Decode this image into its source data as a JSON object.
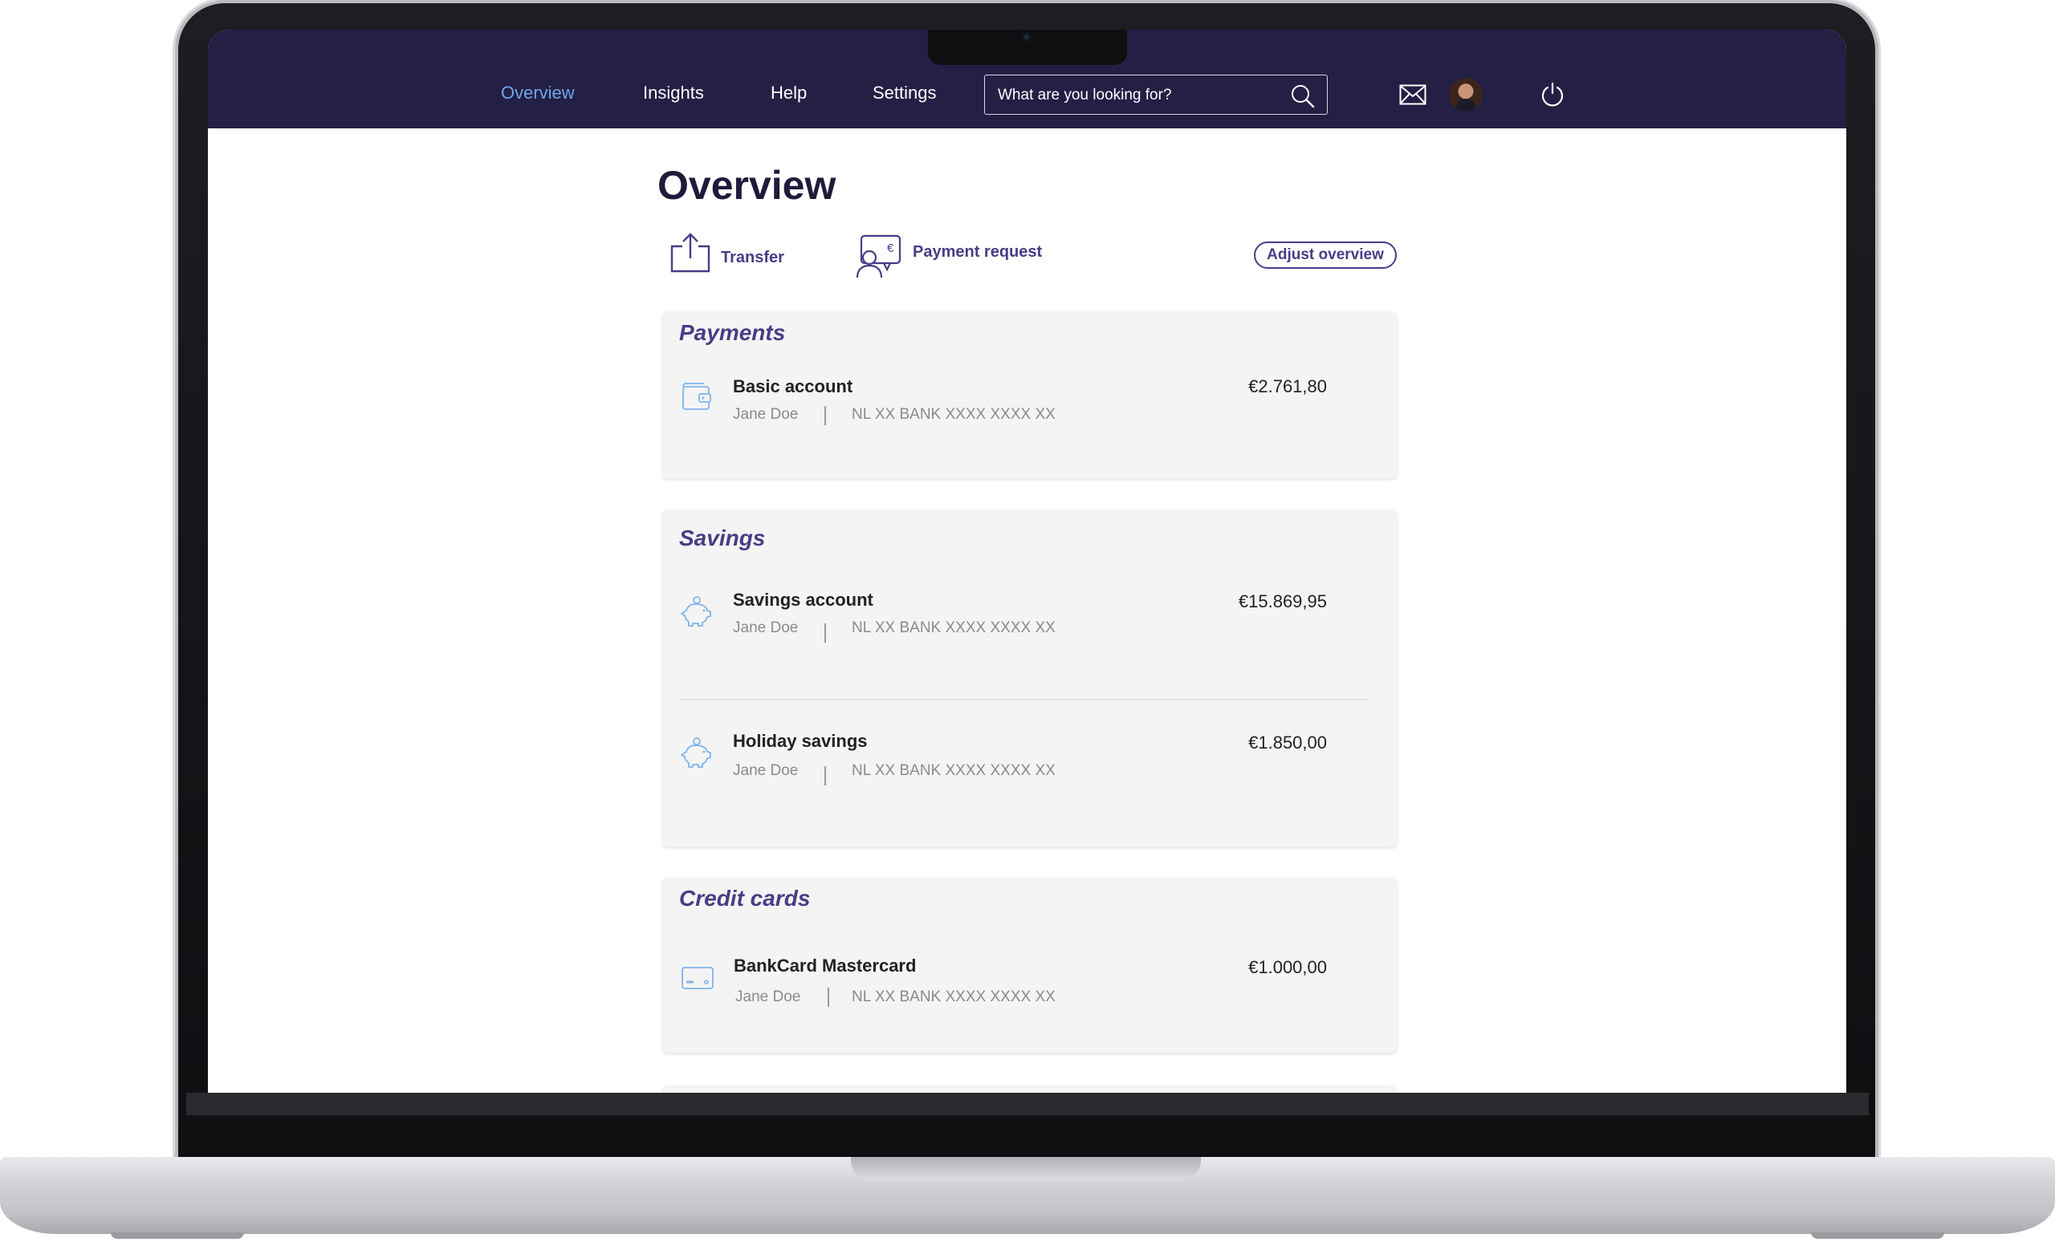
{
  "nav": {
    "items": [
      {
        "label": "Overview",
        "active": true
      },
      {
        "label": "Insights",
        "active": false
      },
      {
        "label": "Help",
        "active": false
      },
      {
        "label": "Settings",
        "active": false
      }
    ],
    "search_placeholder": "What are you looking for?",
    "icons": [
      "search-icon",
      "mail-icon",
      "power-icon"
    ],
    "bar_color": "#231f45",
    "active_color": "#6fa6e8"
  },
  "page": {
    "title": "Overview",
    "actions": {
      "transfer": "Transfer",
      "payment_request": "Payment request",
      "adjust_overview": "Adjust overview"
    },
    "accent_color": "#463e86"
  },
  "sections": {
    "payments": {
      "title": "Payments",
      "accounts": [
        {
          "name": "Basic account",
          "owner": "Jane Doe",
          "iban": "NL XX BANK XXXX XXXX XX",
          "balance": "€2.761,80",
          "icon": "wallet-icon"
        }
      ]
    },
    "savings": {
      "title": "Savings",
      "accounts": [
        {
          "name": "Savings account",
          "owner": "Jane Doe",
          "iban": "NL XX BANK XXXX XXXX XX",
          "balance": "€15.869,95",
          "icon": "piggy-bank-icon"
        },
        {
          "name": "Holiday savings",
          "owner": "Jane Doe",
          "iban": "NL XX BANK XXXX XXXX XX",
          "balance": "€1.850,00",
          "icon": "piggy-bank-icon"
        }
      ]
    },
    "credit_cards": {
      "title": "Credit cards",
      "accounts": [
        {
          "name": "BankCard Mastercard",
          "owner": "Jane Doe",
          "iban": "NL XX BANK XXXX XXXX XX",
          "balance": "€1.000,00",
          "icon": "credit-card-icon"
        }
      ]
    }
  }
}
